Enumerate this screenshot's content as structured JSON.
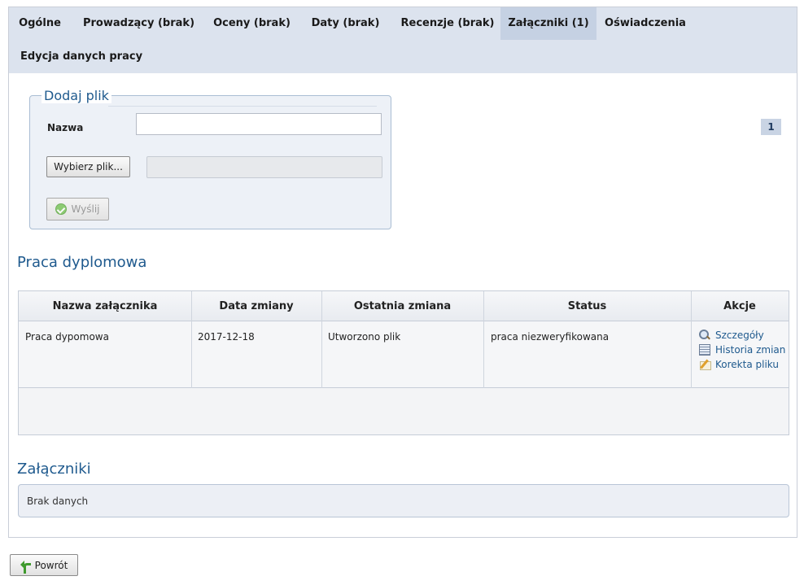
{
  "tabs": [
    {
      "label": "Ogólne",
      "active": false
    },
    {
      "label": "Prowadzący (brak)",
      "active": false
    },
    {
      "label": "Oceny (brak)",
      "active": false
    },
    {
      "label": "Daty (brak)",
      "active": false
    },
    {
      "label": "Recenzje (brak)",
      "active": false
    },
    {
      "label": "Załączniki (1)",
      "active": true
    },
    {
      "label": "Oświadczenia",
      "active": false
    },
    {
      "label": "Edycja danych pracy",
      "active": false
    }
  ],
  "upload": {
    "legend": "Dodaj plik",
    "name_label": "Nazwa",
    "name_value": "",
    "choose_button": "Wybierz plik...",
    "send_button": "Wyślij"
  },
  "thesis_section": {
    "title": "Praca dyplomowa",
    "columns": [
      "Nazwa załącznika",
      "Data zmiany",
      "Ostatnia zmiana",
      "Status",
      "Akcje"
    ],
    "rows": [
      {
        "name": "Praca dypomowa",
        "date": "2017-12-18",
        "last_change": "Utworzono plik",
        "status": "praca niezweryfikowana",
        "actions": [
          {
            "label": "Szczegóły",
            "icon": "magnifier-icon"
          },
          {
            "label": "Historia zmian",
            "icon": "list-icon"
          },
          {
            "label": "Korekta pliku",
            "icon": "pencil-icon"
          }
        ]
      }
    ],
    "pager": {
      "current_page": "1"
    }
  },
  "attachments_section": {
    "title": "Załączniki",
    "empty_text": "Brak danych"
  },
  "back_button": "Powrót",
  "colors": {
    "tabbar_bg": "#dce3ee",
    "active_tab_bg": "#c5d1e3",
    "section_title": "#1f5a8e",
    "link": "#1f5a8e"
  }
}
